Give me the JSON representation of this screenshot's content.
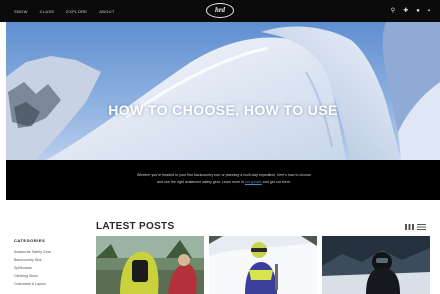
{
  "nav": {
    "items": [
      "SNOW",
      "CLASS",
      "EXPLORE",
      "ABOUT"
    ]
  },
  "logo": {
    "text": "hrd"
  },
  "header_icons": [
    "location-icon",
    "plus-icon",
    "user-icon",
    "cart-icon"
  ],
  "hero": {
    "title": "HOW TO CHOOSE, HOW TO USE"
  },
  "intro": {
    "line1": "Whether you're headed to your first backcountry tour or planning a multi-day expedition, here's how to choose",
    "line2_pre": "and use the right avalanche safety gear. Learn more in",
    "line2_link": "our guides",
    "line2_post": "and get out there."
  },
  "sidebar": {
    "title": "CATEGORIES",
    "items": [
      "Avalanche Safety Gear",
      "Backcountry Skis",
      "Splitboards",
      "Climbing Skins",
      "Outerwear & Layers"
    ]
  },
  "latest": {
    "title": "LATEST POSTS"
  }
}
